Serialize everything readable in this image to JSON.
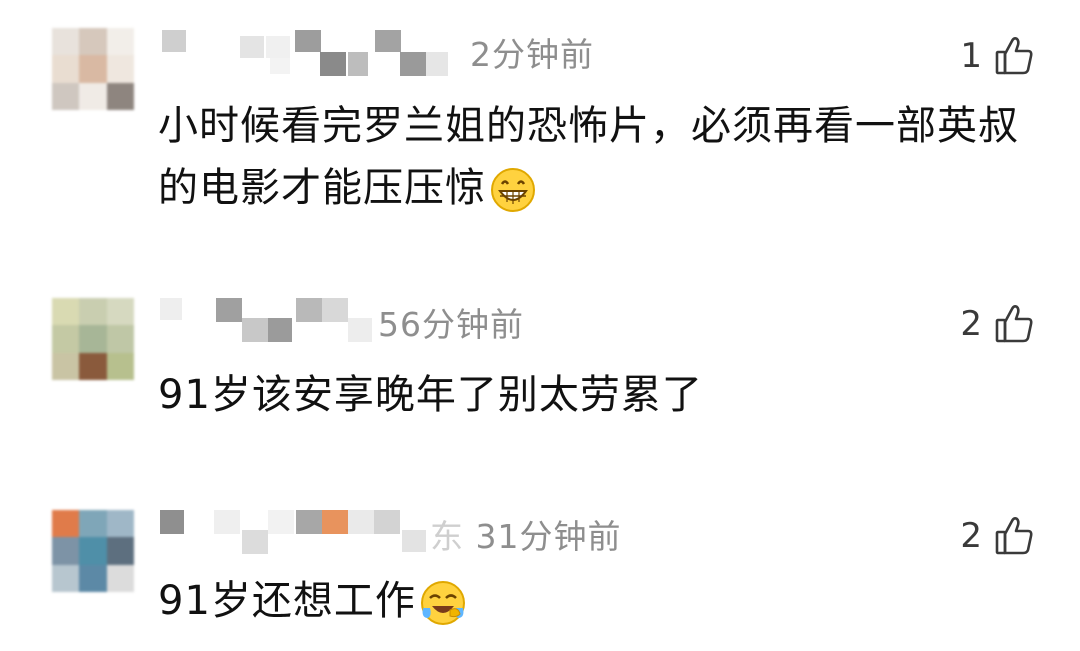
{
  "comments": [
    {
      "time": "2分钟前",
      "likes": "1",
      "text_lines": [
        "小时候看完罗兰姐的恐怖片，必须再看一部英叔",
        "的电影才能压压惊"
      ],
      "emoji": "grinning-face-emoji"
    },
    {
      "time": "56分钟前",
      "likes": "2",
      "text_lines": [
        "91岁该安享晚年了别太劳累了"
      ]
    },
    {
      "time": "31分钟前",
      "likes": "2",
      "text_lines": [
        "91岁还想工作"
      ],
      "emoji": "face-with-tears-of-joy-emoji",
      "name_suffix": "东"
    }
  ],
  "icons": {
    "like": "thumbs-up-icon"
  },
  "colors": {
    "time": "#8e8e8e",
    "text": "#111111",
    "likes": "#3a3a3a"
  }
}
